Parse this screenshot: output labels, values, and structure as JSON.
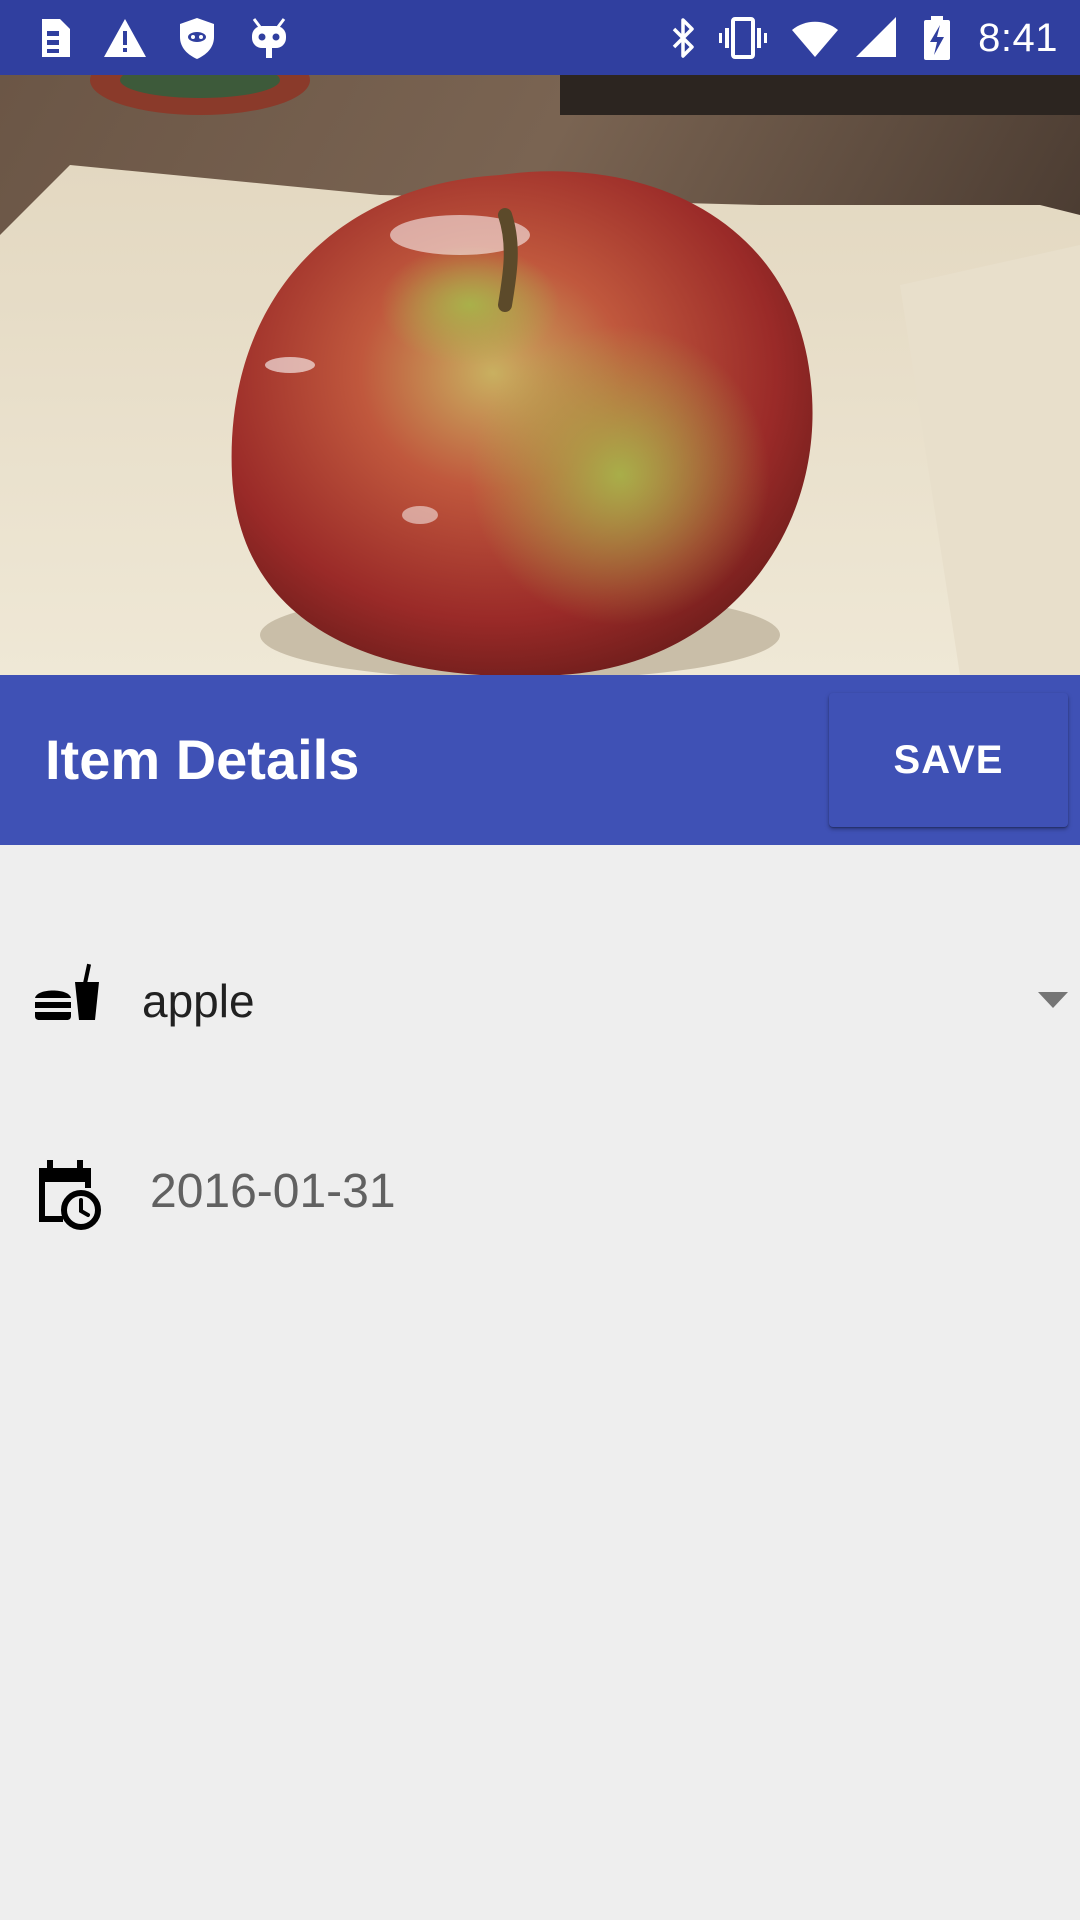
{
  "status_bar": {
    "time": "8:41",
    "left_icons": [
      "sim-card-icon",
      "warning-icon",
      "shield-icon",
      "android-debug-icon"
    ],
    "right_icons": [
      "bluetooth-icon",
      "vibrate-icon",
      "wifi-icon",
      "signal-icon",
      "battery-charging-icon"
    ]
  },
  "photo": {
    "subject": "apple-photo"
  },
  "app_bar": {
    "title": "Item Details",
    "save_label": "SAVE",
    "color": "#3f51b5",
    "status_color": "#303f9f"
  },
  "form": {
    "item": {
      "icon": "fastfood-icon",
      "value": "apple"
    },
    "date": {
      "icon": "calendar-clock-icon",
      "value": "2016-01-31"
    }
  }
}
